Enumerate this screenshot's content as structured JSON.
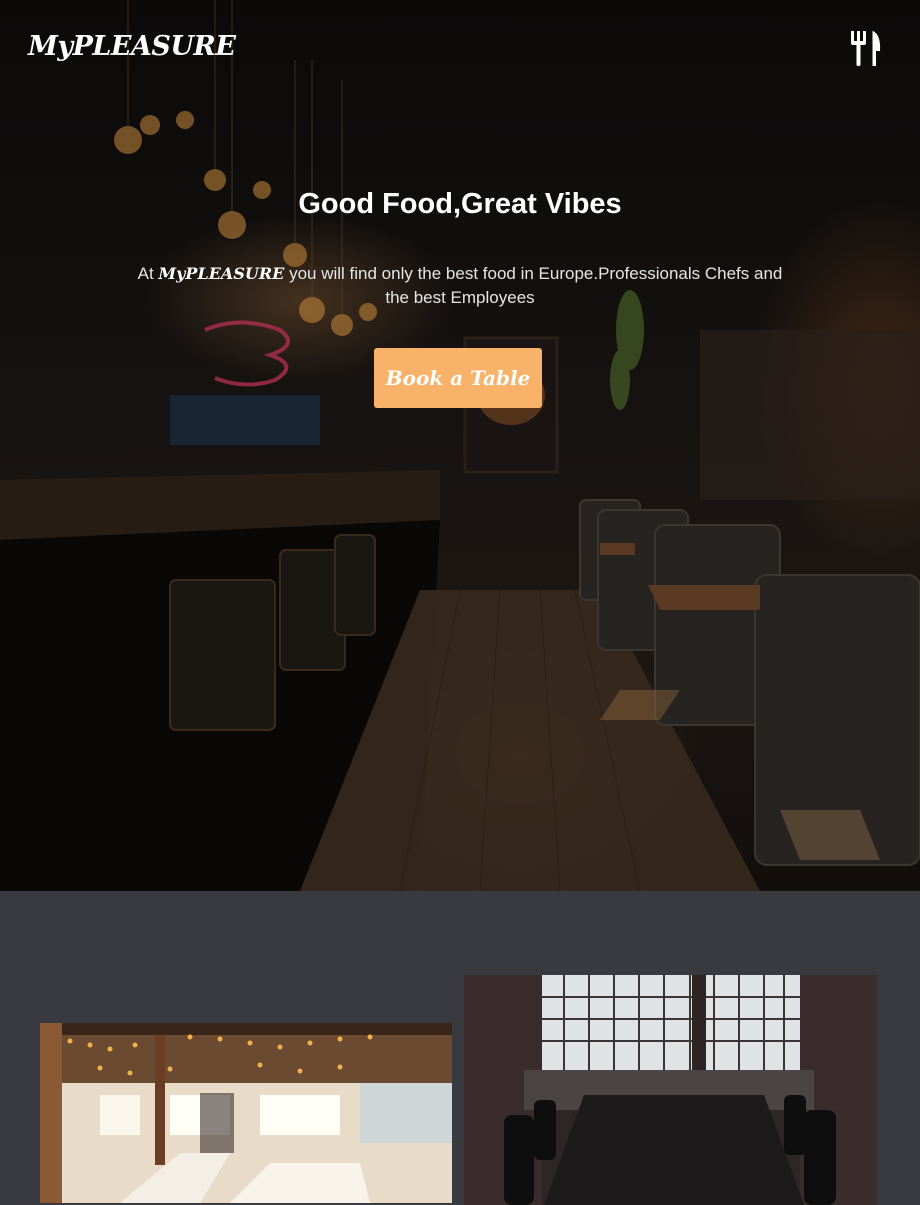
{
  "header": {
    "logo": "MyPLEASURE",
    "menu_icon": "fork-knife-icon"
  },
  "hero": {
    "headline": "Good Food,Great Vibes",
    "intro_prefix": "At",
    "intro_brand": "MyPLEASURE",
    "intro_suffix": "you will find only the best food in Europe.Professionals Chefs and the best Employees",
    "cta_label": "Book a Table",
    "cta_color": "#f8b26a"
  },
  "colors": {
    "section_background": "#393a40",
    "hero_overlay": "#0b0a09"
  }
}
